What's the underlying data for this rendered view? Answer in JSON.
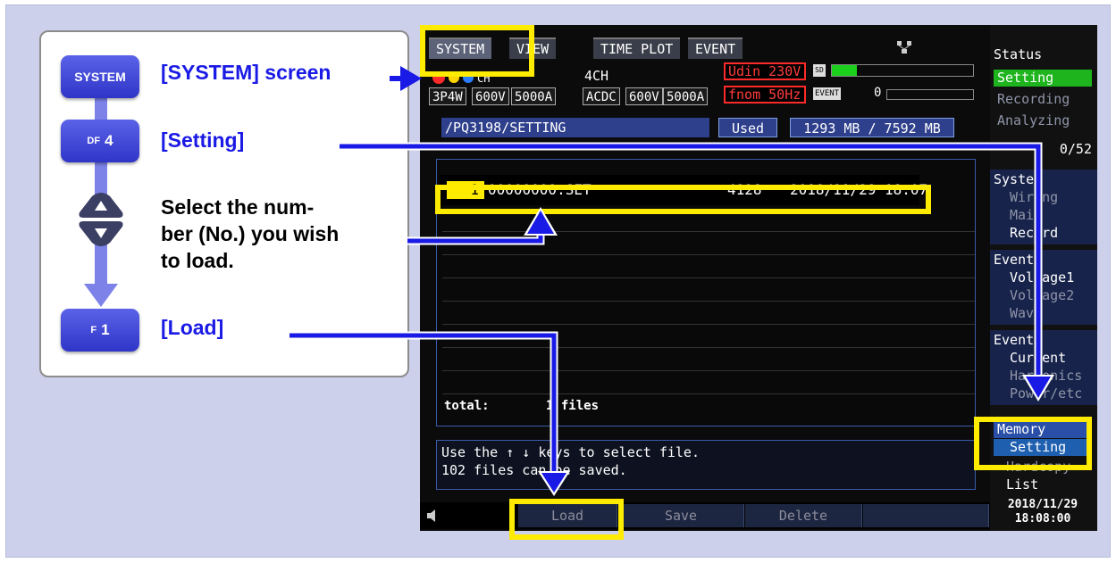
{
  "instructions": {
    "keys": {
      "system": "SYSTEM",
      "df4_prefix": "DF",
      "df4_num": "4",
      "f1_prefix": "F",
      "f1_num": "1"
    },
    "steps": {
      "system_label": "[SYSTEM] screen",
      "setting_label": "[Setting]",
      "select_line1": "Select the num-",
      "select_line2": "ber (No.) you wish",
      "select_line3": "to load.",
      "load_label": "[Load]"
    }
  },
  "device": {
    "tabs": [
      "SYSTEM",
      "VIEW",
      "TIME PLOT",
      "EVENT"
    ],
    "channel": {
      "ch4": "4CH",
      "wiring": "3P4W",
      "v1": "600V",
      "a1": "5000A",
      "mode": "ACDC",
      "v2": "600V",
      "a2": "5000A"
    },
    "udin": "Udin 230V",
    "fnom": "fnom  50Hz",
    "sd_badge": "SD",
    "event_badge": "EVENT",
    "event_count": "0",
    "path": "/PQ3198/SETTING",
    "used_label": "Used",
    "memory_usage": "1293 MB /  7592 MB",
    "file_count": "0/52",
    "files": [
      {
        "no": "1",
        "name": "00000000.SET",
        "size": "4128",
        "date": "2018/11/29 18:07"
      }
    ],
    "total_label": "total:",
    "total_files": "1 files",
    "message_line1": "Use the ↑ ↓ keys to select file.",
    "message_line2": "102 files can be saved.",
    "fkeys": [
      "Load",
      "Save",
      "Delete",
      ""
    ],
    "status": {
      "title": "Status",
      "setting": "Setting",
      "recording": "Recording",
      "analyzing": "Analyzing"
    },
    "side": {
      "system_title": "System",
      "wiring": "Wiring",
      "main": "Main",
      "record": "Record",
      "event1_title": "Event1",
      "voltage1": "Voltage1",
      "voltage2": "Voltage2",
      "wave": "Wave",
      "event2_title": "Event2",
      "current": "Current",
      "harmonics": "Harmonics",
      "power": "Power/etc",
      "memory_title": "Memory",
      "memory_setting": "Setting",
      "hardcopy": "Hardcopy",
      "list": "List",
      "date": "2018/11/29",
      "time": "18:08:00"
    }
  },
  "colors": {
    "frame_bg": "#cdd0ea",
    "key_blue": "#2f35c7",
    "arrow_blue": "#1a1ae6",
    "highlight": "#ffeb00",
    "device_bg": "#0b0b0b"
  }
}
